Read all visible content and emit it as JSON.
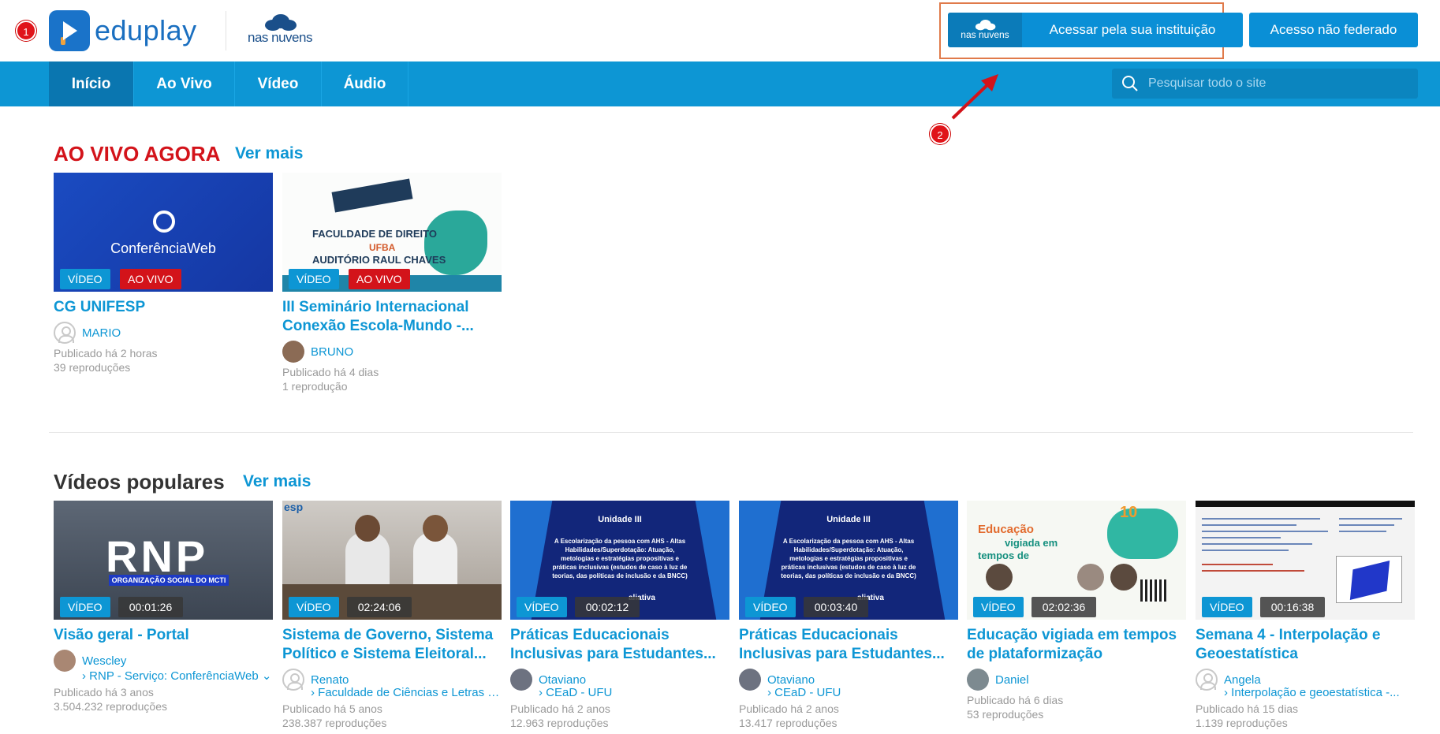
{
  "header": {
    "logo_text": "eduplay",
    "partner_logo_text": "nas nuvens",
    "login_institution": {
      "badge_text": "nas nuvens",
      "label": "Acessar pela sua instituição"
    },
    "login_non_federated": "Acesso não federado"
  },
  "annotations": [
    "1",
    "2"
  ],
  "nav": {
    "tabs": [
      {
        "label": "Início",
        "active": true
      },
      {
        "label": "Ao Vivo",
        "active": false
      },
      {
        "label": "Vídeo",
        "active": false
      },
      {
        "label": "Áudio",
        "active": false
      }
    ],
    "search_placeholder": "Pesquisar todo o site"
  },
  "live": {
    "title": "AO VIVO AGORA",
    "more": "Ver mais",
    "cards": [
      {
        "thumb_text": "ConferênciaWeb",
        "tags": [
          "VÍDEO",
          "AO VIVO"
        ],
        "title": "CG UNIFESP",
        "author": "MARIO",
        "published": "Publicado há 2 horas",
        "plays": "39 reproduções"
      },
      {
        "thumb_lines": [
          "FACULDADE DE DIREITO",
          "UFBA",
          "AUDITÓRIO RAUL CHAVES"
        ],
        "tags": [
          "VÍDEO",
          "AO VIVO"
        ],
        "title": "III Seminário Internacional Conexão Escola-Mundo -...",
        "author": "BRUNO",
        "published": "Publicado há 4 dias",
        "plays": "1 reprodução"
      }
    ]
  },
  "popular": {
    "title": "Vídeos populares",
    "more": "Ver mais",
    "cards": [
      {
        "thumb_big": "RNP",
        "thumb_sub": "ORGANIZAÇÃO SOCIAL DO MCTI",
        "tag": "VÍDEO",
        "duration": "00:01:26",
        "title": "Visão geral - Portal",
        "author": "Wescley",
        "channel": "› RNP - Serviço: ConferênciaWeb ⌄",
        "published": "Publicado há 3 anos",
        "plays": "3.504.232 reproduções"
      },
      {
        "thumb_corner": "esp",
        "tag": "VÍDEO",
        "duration": "02:24:06",
        "title": "Sistema de Governo, Sistema Político e Sistema Eleitoral...",
        "author": "Renato",
        "channel": "› Faculdade de Ciências e Letras d...",
        "published": "Publicado há 5 anos",
        "plays": "238.387 reproduções"
      },
      {
        "thumb_heading": "Unidade III",
        "thumb_text": "A Escolarização da pessoa com AHS - Altas Habilidades/Superdotação: Atuação, metologias e estratégias propositivas e práticas inclusivas (estudos de caso à luz de teorias, das políticas de inclusão e da BNCC)",
        "thumb_footer": "aliativa",
        "tag": "VÍDEO",
        "duration": "00:02:12",
        "title": "Práticas Educacionais Inclusivas para Estudantes...",
        "author": "Otaviano",
        "channel": "› CEaD - UFU",
        "published": "Publicado há 2 anos",
        "plays": "12.963 reproduções"
      },
      {
        "thumb_heading": "Unidade III",
        "thumb_text": "A Escolarização da pessoa com AHS - Altas Habilidades/Superdotação: Atuação, metologias e estratégias propositivas e práticas inclusivas (estudos de caso à luz de teorias, das políticas de inclusão e da BNCC)",
        "thumb_footer": "aliativa",
        "tag": "VÍDEO",
        "duration": "00:03:40",
        "title": "Práticas Educacionais Inclusivas para Estudantes...",
        "author": "Otaviano",
        "channel": "› CEaD - UFU",
        "published": "Publicado há 2 anos",
        "plays": "13.417 reproduções"
      },
      {
        "thumb_lines": [
          "Educação",
          "vigiada em",
          "tempos de"
        ],
        "thumb_badge": "10",
        "tag": "VÍDEO",
        "duration": "02:02:36",
        "title": "Educação vigiada em tempos de plataformização",
        "author": "Daniel",
        "channel": "",
        "published": "Publicado há 6 dias",
        "plays": "53 reproduções"
      },
      {
        "tag": "VÍDEO",
        "duration": "00:16:38",
        "title": "Semana 4 - Interpolação e Geoestatística",
        "author": "Angela",
        "channel": "› Interpolação e geoestatística -...",
        "published": "Publicado há 15 dias",
        "plays": "1.139 reproduções"
      }
    ]
  },
  "colors": {
    "primary": "#0d96d4",
    "nav_active": "#0a76b0",
    "live_red": "#d3131a",
    "annotation_orange": "#e07a4a"
  }
}
